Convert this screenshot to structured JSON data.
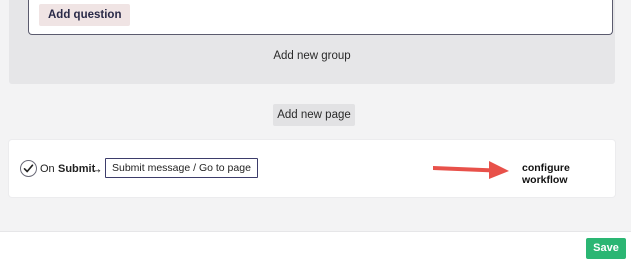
{
  "form": {
    "add_question_label": "Add question",
    "add_group_label": "Add new group",
    "add_page_label": "Add new page"
  },
  "workflow": {
    "checked": true,
    "on_label": "On",
    "event_label": "Submit",
    "arrow": "→",
    "action_label": "Submit message / Go to page",
    "configure_label": "configure workflow",
    "annotation_arrow_color": "#e8514a",
    "check_icon": "checkmark-icon"
  },
  "footer": {
    "save_label": "Save",
    "save_color": "#2bb673"
  }
}
